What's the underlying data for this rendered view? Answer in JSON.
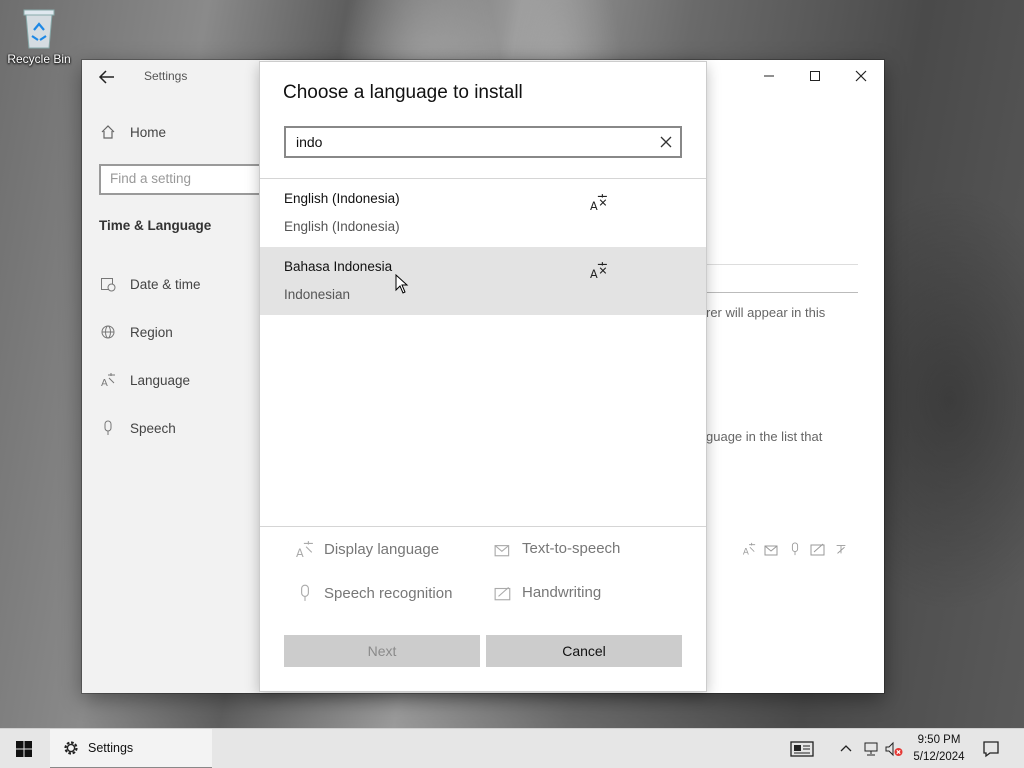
{
  "desktop": {
    "recycle_bin_label": "Recycle Bin"
  },
  "settings": {
    "title": "Settings",
    "home": "Home",
    "search_placeholder": "Find a setting",
    "section": "Time & Language",
    "nav": [
      {
        "label": "Date & time",
        "icon": "calendar-clock-icon"
      },
      {
        "label": "Region",
        "icon": "globe-icon"
      },
      {
        "label": "Language",
        "icon": "language-icon"
      },
      {
        "label": "Speech",
        "icon": "microphone-icon"
      }
    ],
    "bg_text_1": "rer will appear in this",
    "bg_text_2": "guage in the list that"
  },
  "dialog": {
    "title": "Choose a language to install",
    "search_value": "indo",
    "languages": [
      {
        "name": "English (Indonesia)",
        "native": "English (Indonesia)",
        "selected": false,
        "feature": "display-language-icon"
      },
      {
        "name": "Bahasa Indonesia",
        "native": "Indonesian",
        "selected": true,
        "feature": "display-language-icon"
      }
    ],
    "legend": {
      "display_language": "Display language",
      "text_to_speech": "Text-to-speech",
      "speech_recognition": "Speech recognition",
      "handwriting": "Handwriting"
    },
    "buttons": {
      "next": "Next",
      "cancel": "Cancel"
    }
  },
  "taskbar": {
    "app_label": "Settings",
    "time": "9:50 PM",
    "date": "5/12/2024"
  },
  "colors": {
    "accent": "#0078d7",
    "selected_row": "#e3e3e3",
    "button_gray": "#cccccc"
  }
}
